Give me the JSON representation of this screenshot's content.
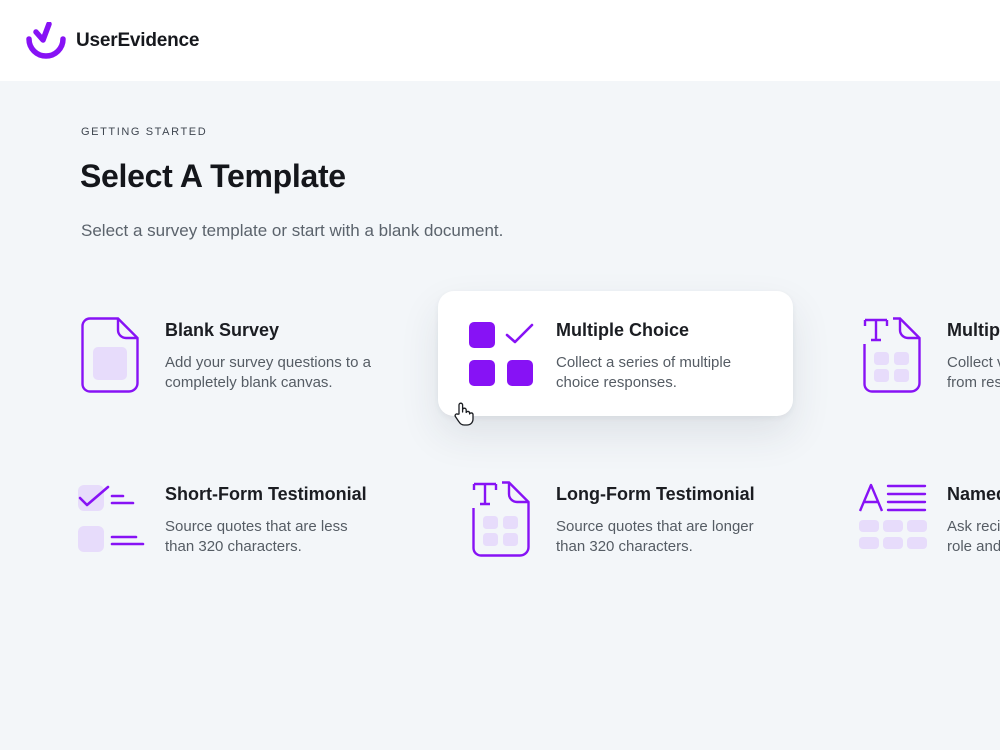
{
  "header": {
    "brand": "UserEvidence"
  },
  "page": {
    "eyebrow": "GETTING STARTED",
    "title": "Select A Template",
    "subtitle": "Select a survey template or start with a blank document."
  },
  "templates": [
    {
      "title": "Blank Survey",
      "description": "Add your survey questions to a completely blank canvas.",
      "icon": "blank-document-icon"
    },
    {
      "title": "Multiple Choice",
      "description": "Collect a series of multiple choice responses.",
      "icon": "multiple-choice-grid-icon"
    },
    {
      "title": "Multip",
      "description": "Collect v from res",
      "icon": "text-document-icon"
    },
    {
      "title": "Short-Form Testimonial",
      "description": "Source quotes that are less than 320 characters.",
      "icon": "short-form-checklist-icon"
    },
    {
      "title": "Long-Form Testimonial",
      "description": "Source quotes that are longer than 320 characters.",
      "icon": "text-document-icon"
    },
    {
      "title": "Named",
      "description": "Ask reci role and",
      "icon": "named-form-icon"
    }
  ],
  "colors": {
    "accent": "#8712f5",
    "accent_light": "#e7dcfb",
    "background": "#f3f6f9"
  }
}
